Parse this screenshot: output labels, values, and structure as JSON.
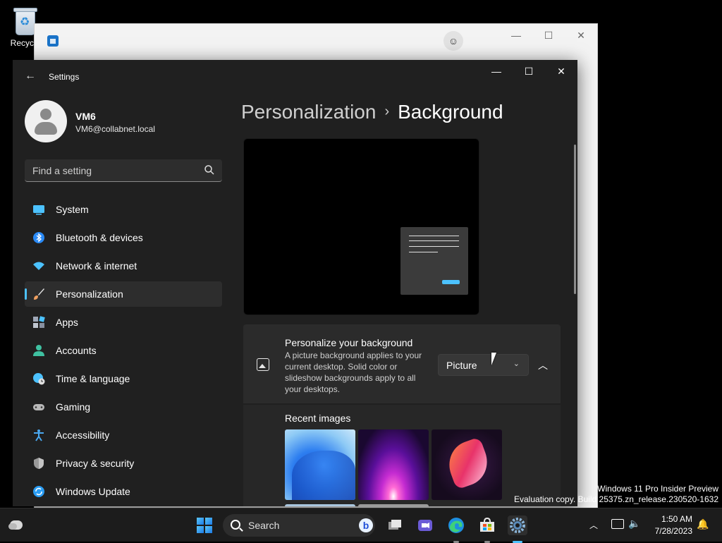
{
  "desktop": {
    "recycle_bin_label": "Recycle"
  },
  "settings": {
    "title": "Settings",
    "user": {
      "name": "VM6",
      "email": "VM6@collabnet.local"
    },
    "search": {
      "placeholder": "Find a setting"
    },
    "nav": [
      {
        "label": "System",
        "icon": "system-icon",
        "color": "#4cc2ff"
      },
      {
        "label": "Bluetooth & devices",
        "icon": "bluetooth-icon",
        "color": "#2a8af6"
      },
      {
        "label": "Network & internet",
        "icon": "wifi-icon",
        "color": "#4cc2ff"
      },
      {
        "label": "Personalization",
        "icon": "brush-icon",
        "color": "#f0a060",
        "active": true
      },
      {
        "label": "Apps",
        "icon": "apps-icon",
        "color": "#a0a8b8"
      },
      {
        "label": "Accounts",
        "icon": "person-icon",
        "color": "#3fc1a1"
      },
      {
        "label": "Time & language",
        "icon": "globe-clock-icon",
        "color": "#4cc2ff"
      },
      {
        "label": "Gaming",
        "icon": "gamepad-icon",
        "color": "#b8b8b8"
      },
      {
        "label": "Accessibility",
        "icon": "accessibility-icon",
        "color": "#4aa8f0"
      },
      {
        "label": "Privacy & security",
        "icon": "shield-icon",
        "color": "#9a9a9a"
      },
      {
        "label": "Windows Update",
        "icon": "update-icon",
        "color": "#2a9df4"
      }
    ],
    "breadcrumb": {
      "parent": "Personalization",
      "separator": "›",
      "current": "Background"
    },
    "background_card": {
      "title": "Personalize your background",
      "description": "A picture background applies to your current desktop. Solid color or slideshow backgrounds apply to all your desktops.",
      "dropdown_value": "Picture"
    },
    "recent_images_label": "Recent images",
    "accent_color": "#4cc2ff"
  },
  "watermark": {
    "line1": "Windows 11 Pro Insider Preview",
    "line2": "Evaluation copy. Build 25375.zn_release.230520-1632"
  },
  "taskbar": {
    "search_label": "Search",
    "time": "1:50 AM",
    "date": "7/28/2023"
  }
}
